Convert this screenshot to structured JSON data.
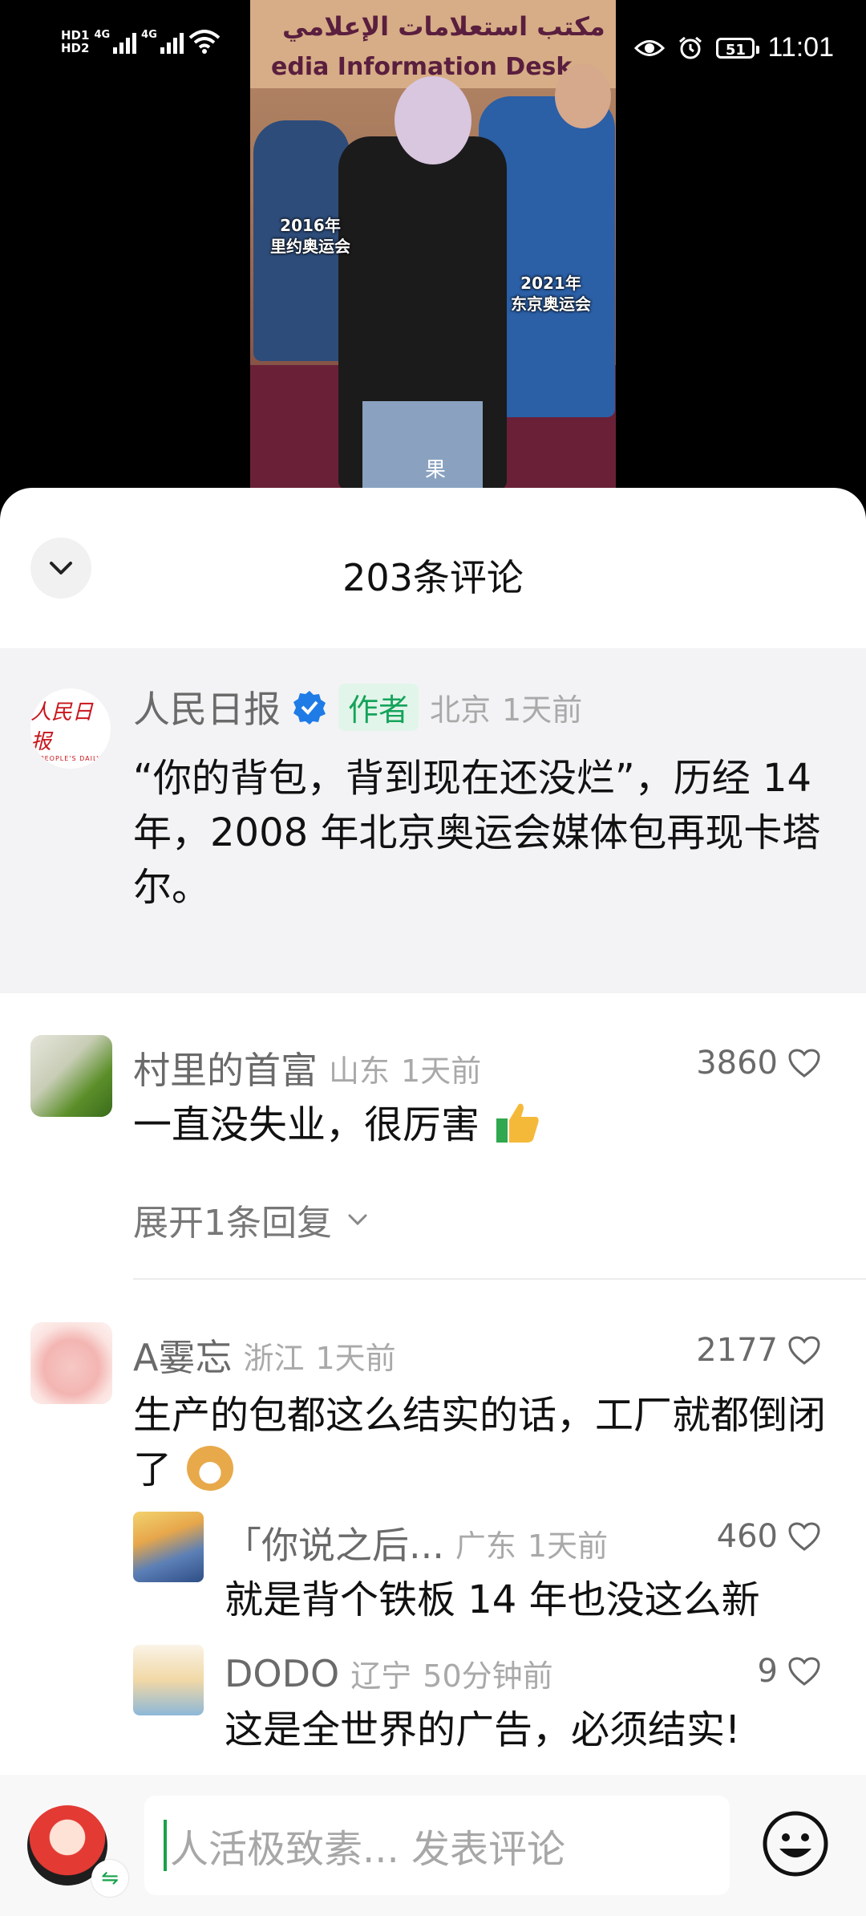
{
  "status_bar": {
    "network": [
      "HD1",
      "HD2"
    ],
    "signal1": "4G",
    "signal2": "4G",
    "battery": "51",
    "time": "11:01"
  },
  "video": {
    "sign_arabic": "مكتب استعلامات الإعلامي",
    "sign_english": "edia Information Desk",
    "caption_left": "2016年\n里约奥运会",
    "caption_right": "2021年\n东京奥运会",
    "watermark": "果"
  },
  "comments_panel": {
    "title": "203条评论",
    "author_post": {
      "name": "人民日报",
      "badge": "作者",
      "location": "北京",
      "time": "1天前",
      "text": "“你的背包，背到现在还没烂”，历经 14 年，2008 年北京奥运会媒体包再现卡塔尔。",
      "avatar_text": "人民日报",
      "avatar_sub": "PEOPLE'S DAILY"
    },
    "comments": [
      {
        "name": "村里的首富",
        "location": "山东",
        "time": "1天前",
        "likes": "3860",
        "text": "一直没失业，很厉害",
        "expand_label": "展开1条回复"
      },
      {
        "name": "A霎忘",
        "location": "浙江",
        "time": "1天前",
        "likes": "2177",
        "text": "生产的包都这么结实的话，工厂就都倒闭了",
        "replies": [
          {
            "name": "「你说之后...",
            "location": "广东",
            "time": "1天前",
            "likes": "460",
            "text": "就是背个铁板 14 年也没这么新"
          },
          {
            "name": "DODO",
            "location": "辽宁",
            "time": "50分钟前",
            "likes": "9",
            "text": "这是全世界的广告，必须结实!"
          }
        ]
      }
    ]
  },
  "input_bar": {
    "placeholder": "人活极致素... 发表评论"
  }
}
